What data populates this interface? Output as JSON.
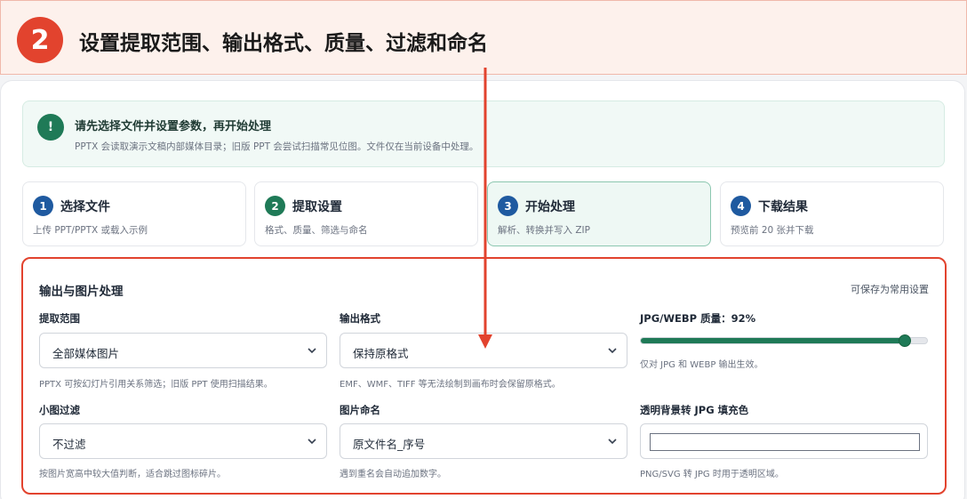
{
  "banner": {
    "step": "2",
    "title": "设置提取范围、输出格式、质量、过滤和命名"
  },
  "notice": {
    "icon": "exclamation-icon",
    "icon_glyph": "!",
    "title": "请先选择文件并设置参数，再开始处理",
    "text": "PPTX 会读取演示文稿内部媒体目录；旧版 PPT 会尝试扫描常见位图。文件仅在当前设备中处理。"
  },
  "steps": [
    {
      "num": "1",
      "title": "选择文件",
      "sub": "上传 PPT/PPTX 或载入示例"
    },
    {
      "num": "2",
      "title": "提取设置",
      "sub": "格式、质量、筛选与命名"
    },
    {
      "num": "3",
      "title": "开始处理",
      "sub": "解析、转换并写入 ZIP"
    },
    {
      "num": "4",
      "title": "下载结果",
      "sub": "预览前 20 张并下载"
    }
  ],
  "settings": {
    "title": "输出与图片处理",
    "save_link": "可保存为常用设置",
    "scope": {
      "label": "提取范围",
      "value": "全部媒体图片",
      "hint": "PPTX 可按幻灯片引用关系筛选；旧版 PPT 使用扫描结果。"
    },
    "format": {
      "label": "输出格式",
      "value": "保持原格式",
      "hint": "EMF、WMF、TIFF 等无法绘制到画布时会保留原格式。"
    },
    "quality": {
      "label": "JPG/WEBP 质量：92%",
      "value": 92,
      "hint": "仅对 JPG 和 WEBP 输出生效。"
    },
    "filter": {
      "label": "小图过滤",
      "value": "不过滤",
      "hint": "按图片宽高中较大值判断，适合跳过图标碎片。"
    },
    "naming": {
      "label": "图片命名",
      "value": "原文件名_序号",
      "hint": "遇到重名会自动追加数字。"
    },
    "fill": {
      "label": "透明背景转 JPG 填充色",
      "color": "#ffffff",
      "hint": "PNG/SVG 转 JPG 时用于透明区域。"
    }
  },
  "colors": {
    "accent_red": "#e2432e",
    "accent_green": "#1f7a57",
    "accent_blue": "#1f5aa0"
  }
}
